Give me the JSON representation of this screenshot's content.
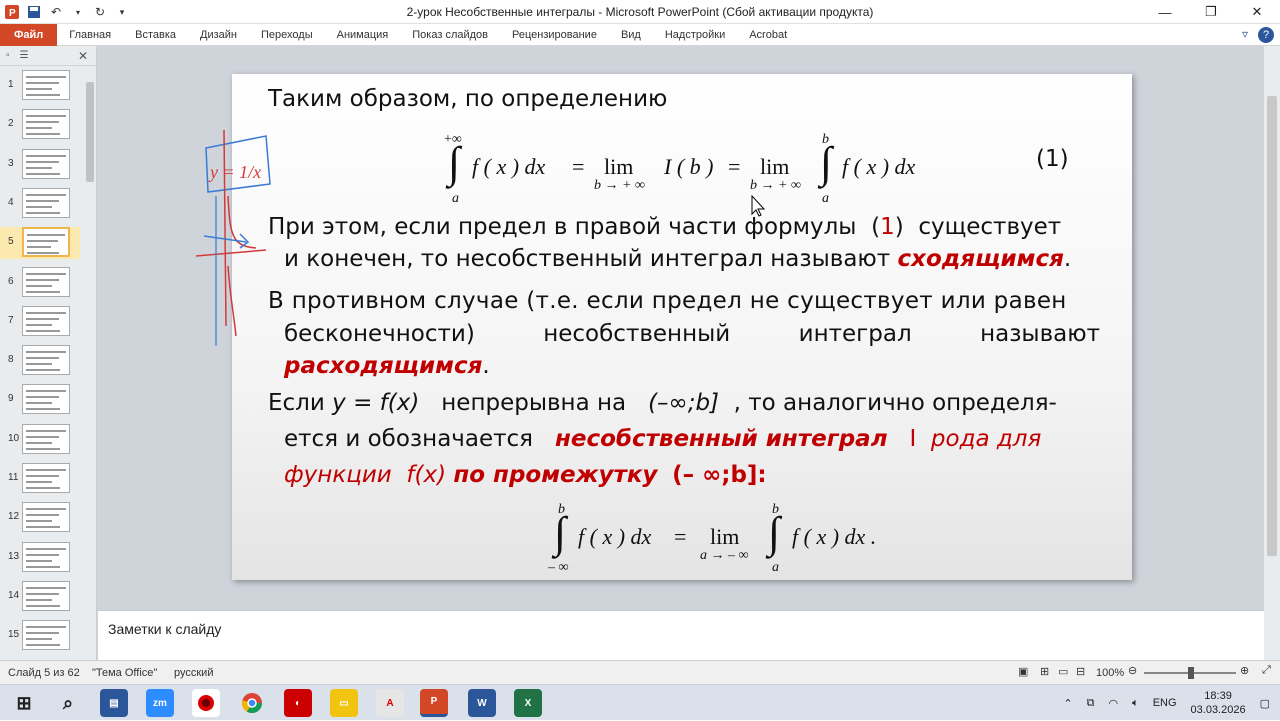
{
  "window": {
    "title": "2-урок Несобственные интегралы  -  Microsoft PowerPoint (Сбой активации продукта)",
    "minimize": "—",
    "restore": "❐",
    "close": "✕"
  },
  "ribbon": {
    "tabs": [
      "Файл",
      "Главная",
      "Вставка",
      "Дизайн",
      "Переходы",
      "Анимация",
      "Показ слайдов",
      "Рецензирование",
      "Вид",
      "Надстройки",
      "Acrobat"
    ]
  },
  "thumbnails": {
    "numbers": [
      "1",
      "2",
      "3",
      "4",
      "5",
      "6",
      "7",
      "8",
      "9",
      "10",
      "11",
      "12",
      "13",
      "14",
      "15"
    ],
    "selected": "5"
  },
  "slide": {
    "line1": "Таким образом, по определению",
    "eq1_label": "(1)",
    "p1_a": "При этом, если предел в правой части формулы",
    "p1_ref": "1",
    "p1_b": "существует",
    "p2_a": "и конечен, то несобственный интеграл называют",
    "p2_b": "сходящимся",
    "p3_a": "В противном случае (т.е. если предел не существует или равен",
    "p3_b1": "бесконечности)",
    "p3_b2": "несобственный",
    "p3_b3": "интеграл",
    "p3_b4": "называют",
    "p3_c": "расходящимся",
    "p4_a": "Если",
    "p4_y": "y = f(x)",
    "p4_b": "непрерывна на",
    "p4_int": "(–∞;b]",
    "p4_c": ", то аналогично определя-",
    "p5_a": "ется  и  обозначается",
    "p5_b": "несобственный  интеграл",
    "p5_c": "I",
    "p5_d": "рода для",
    "p6_a": "функции",
    "p6_b": "f(x)",
    "p6_c": "по промежутку",
    "p6_d": "(– ∞;b]:",
    "eq1": {
      "int_upper": "+∞",
      "int_lower": "a",
      "integrand": "f ( x ) dx",
      "eq": "=",
      "lim": "lim",
      "lim_sub": "b → + ∞",
      "Ib": "I ( b )",
      "eq2": "=",
      "lim2": "lim",
      "lim2_sub": "b → + ∞",
      "int2_upper": "b",
      "int2_lower": "a",
      "integrand2": "f ( x ) dx"
    },
    "eq2": {
      "int_upper": "b",
      "int_lower": "– ∞",
      "integrand": "f ( x ) dx",
      "eq": "=",
      "lim": "lim",
      "lim_sub": "a → – ∞",
      "int2_upper": "b",
      "int2_lower": "a",
      "integrand2": "f ( x ) dx ."
    },
    "annotation": "y = 1/x"
  },
  "notes": {
    "placeholder": "Заметки к слайду"
  },
  "status": {
    "slide": "Слайд 5 из 62",
    "theme": "\"Тема Office\"",
    "lang": "русский",
    "zoom": "100%"
  },
  "taskbar": {
    "lang": "ENG",
    "time": "18:39",
    "date": "03.03.2026",
    "apps": [
      "zm",
      "A",
      "W",
      "X"
    ]
  },
  "colors": {
    "accent_file": "#d24726",
    "emphasis_red": "#c00000",
    "ink_blue": "#3a7bd5",
    "ink_red": "#d23a3a"
  }
}
